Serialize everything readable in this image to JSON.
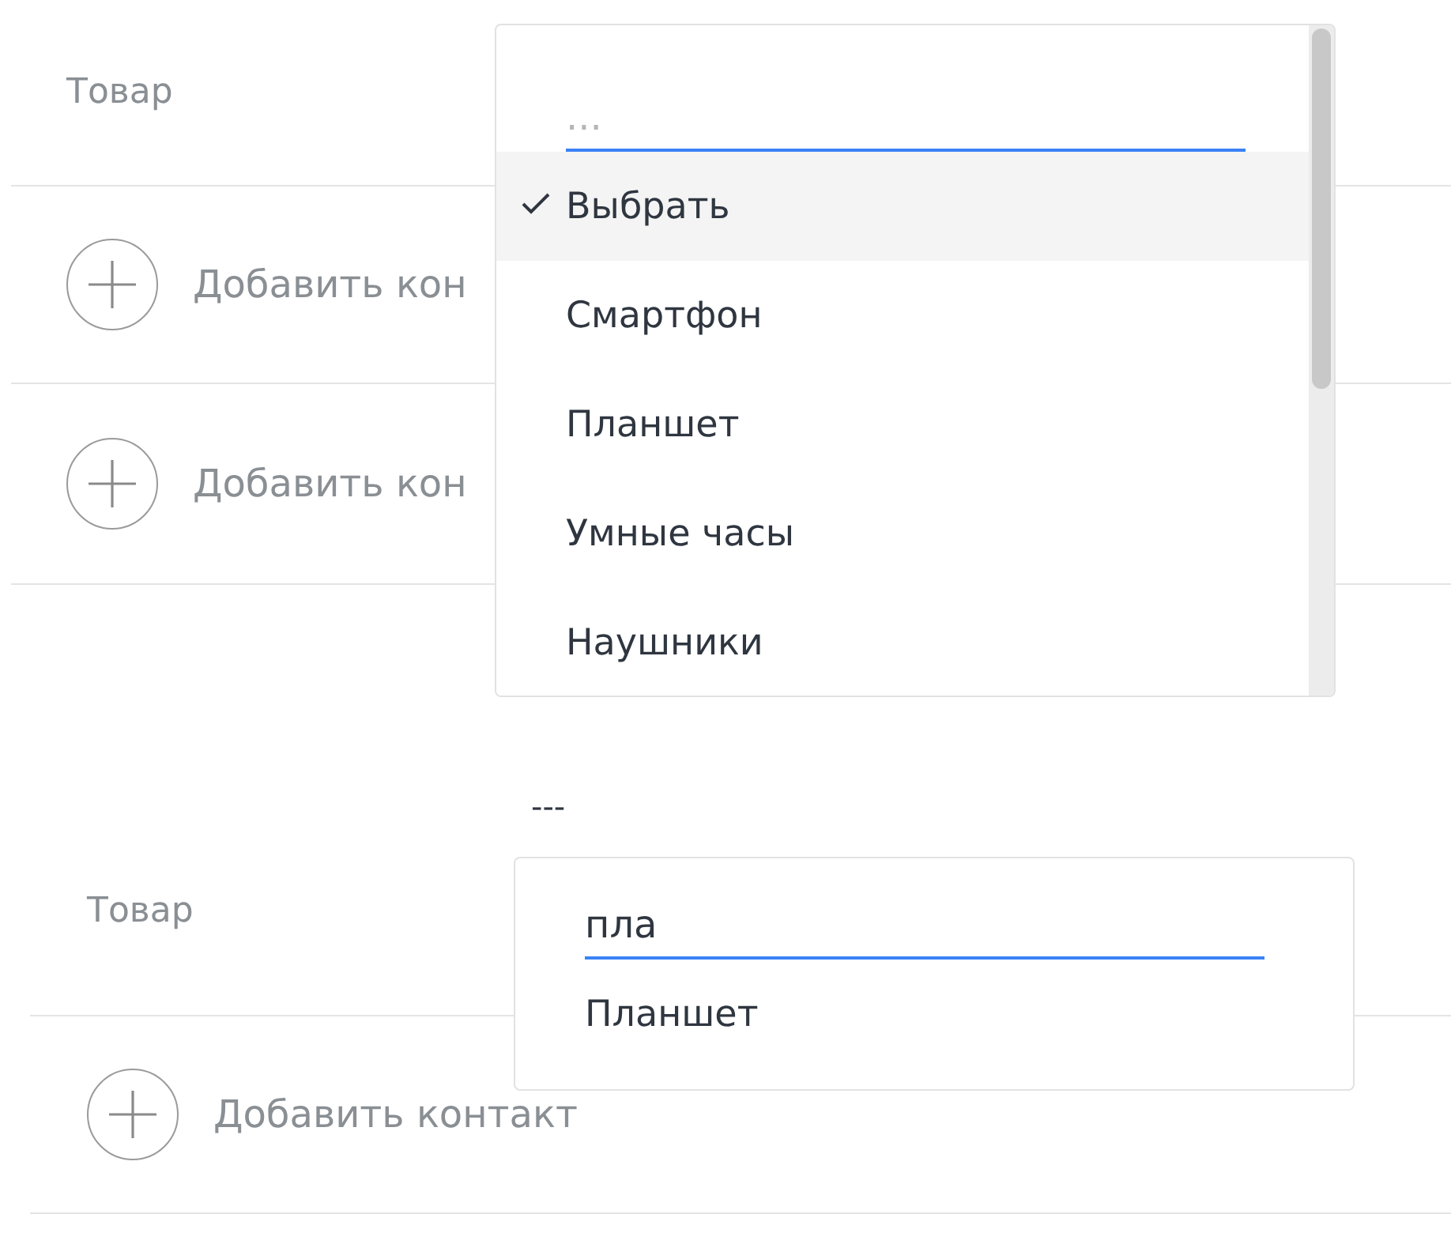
{
  "top_form": {
    "product_label": "Товар",
    "add_contact_rows": [
      "Добавить кон",
      "Добавить кон"
    ],
    "dropdown": {
      "search_placeholder": "...",
      "options": [
        {
          "label": "Выбрать",
          "selected": true
        },
        {
          "label": "Смартфон",
          "selected": false
        },
        {
          "label": "Планшет",
          "selected": false
        },
        {
          "label": "Умные часы",
          "selected": false
        },
        {
          "label": "Наушники",
          "selected": false
        }
      ]
    }
  },
  "bottom_form": {
    "product_label": "Товар",
    "select_value": "---",
    "add_contact_rows": [
      "Добавить контакт"
    ],
    "dropdown": {
      "search_value": "пла",
      "options": [
        {
          "label": "Планшет",
          "selected": false
        }
      ]
    }
  }
}
